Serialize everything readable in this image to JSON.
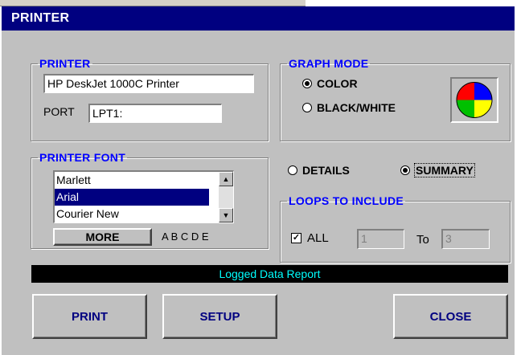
{
  "window": {
    "title": "PRINTER"
  },
  "printer": {
    "legend": "PRINTER",
    "name_value": "HP DeskJet 1000C Printer",
    "port_label": "PORT",
    "port_value": "LPT1:"
  },
  "graph_mode": {
    "legend": "GRAPH MODE",
    "options": [
      {
        "label": "COLOR",
        "selected": true
      },
      {
        "label": "BLACK/WHITE",
        "selected": false
      }
    ],
    "icon": "color-wheel-icon"
  },
  "printer_font": {
    "legend": "PRINTER FONT",
    "fonts": [
      "Marlett",
      "Arial",
      "Courier New"
    ],
    "selected": "Arial",
    "more_label": "MORE",
    "sample_text": "A B C D E"
  },
  "report_type": {
    "options": [
      {
        "label": "DETAILS",
        "selected": false
      },
      {
        "label": "SUMMARY",
        "selected": true
      }
    ]
  },
  "loops": {
    "legend": "LOOPS TO INCLUDE",
    "all_label": "ALL",
    "all_checked": true,
    "from_value": "1",
    "to_label": "To",
    "to_value": "3"
  },
  "status": {
    "text": "Logged Data Report"
  },
  "buttons": {
    "print": "PRINT",
    "setup": "SETUP",
    "close": "CLOSE"
  },
  "colors": {
    "titlebar": "#000080",
    "accent_text": "#0000ff",
    "status_text": "#00ffff",
    "dialog_bg": "#c0c0c0"
  }
}
